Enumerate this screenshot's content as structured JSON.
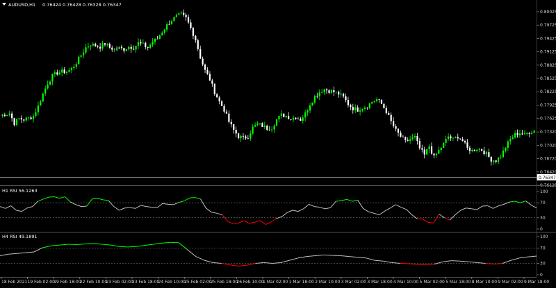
{
  "chart_data": [
    {
      "type": "candlestick",
      "symbol_header": "AUDUSD,H1",
      "ohlc_header": "0.76424 0.76428 0.76328 0.76347",
      "y_ticks": [
        "0.80025",
        "0.79725",
        "0.79425",
        "0.79125",
        "0.78825",
        "0.78525",
        "0.78225",
        "0.77925",
        "0.77625",
        "0.77320",
        "0.77020",
        "0.76720",
        "0.76420",
        "0.76120"
      ],
      "ylim": [
        0.7612,
        0.80025
      ],
      "current_price": "0.76347",
      "bull_color": "#00ff00",
      "bear_color": "#ffffff",
      "x_ticks": [
        "18 Feb 2021",
        "19 Feb 02:00",
        "19 Feb 18:00",
        "22 Feb 10:00",
        "23 Feb 02:00",
        "23 Feb 18:00",
        "24 Feb 10:00",
        "25 Feb 02:00",
        "25 Feb 18:00",
        "26 Feb 10:00",
        "1 Mar 02:00",
        "1 Mar 18:00",
        "2 Mar 10:00",
        "3 Mar 02:00",
        "3 Mar 18:00",
        "4 Mar 10:00",
        "5 Mar 02:00",
        "5 Mar 18:00",
        "8 Mar 10:00",
        "9 Mar 02:00",
        "9 Mar 18:00"
      ],
      "close_path": [
        [
          0,
          0.7768
        ],
        [
          2,
          0.7772
        ],
        [
          4,
          0.7774
        ],
        [
          6,
          0.7752
        ],
        [
          8,
          0.7762
        ],
        [
          10,
          0.776
        ],
        [
          12,
          0.7763
        ],
        [
          14,
          0.7768
        ],
        [
          16,
          0.779
        ],
        [
          18,
          0.7818
        ],
        [
          20,
          0.7842
        ],
        [
          22,
          0.7858
        ],
        [
          24,
          0.7865
        ],
        [
          26,
          0.7868
        ],
        [
          28,
          0.7868
        ],
        [
          30,
          0.7874
        ],
        [
          32,
          0.7888
        ],
        [
          34,
          0.7905
        ],
        [
          36,
          0.7922
        ],
        [
          38,
          0.793
        ],
        [
          40,
          0.7926
        ],
        [
          42,
          0.7924
        ],
        [
          44,
          0.7931
        ],
        [
          46,
          0.7922
        ],
        [
          48,
          0.7918
        ],
        [
          50,
          0.7921
        ],
        [
          52,
          0.7918
        ],
        [
          54,
          0.7924
        ],
        [
          56,
          0.7922
        ],
        [
          58,
          0.7932
        ],
        [
          60,
          0.7928
        ],
        [
          62,
          0.7922
        ],
        [
          64,
          0.7935
        ],
        [
          66,
          0.7942
        ],
        [
          68,
          0.7958
        ],
        [
          70,
          0.7972
        ],
        [
          72,
          0.7984
        ],
        [
          74,
          0.7992
        ],
        [
          76,
          0.7996
        ],
        [
          78,
          0.7988
        ],
        [
          80,
          0.7966
        ],
        [
          82,
          0.794
        ],
        [
          84,
          0.79
        ],
        [
          86,
          0.787
        ],
        [
          88,
          0.785
        ],
        [
          90,
          0.7822
        ],
        [
          92,
          0.78
        ],
        [
          94,
          0.7782
        ],
        [
          96,
          0.7755
        ],
        [
          98,
          0.7736
        ],
        [
          100,
          0.7722
        ],
        [
          102,
          0.7718
        ],
        [
          104,
          0.7722
        ],
        [
          106,
          0.7742
        ],
        [
          108,
          0.775
        ],
        [
          110,
          0.7746
        ],
        [
          112,
          0.774
        ],
        [
          114,
          0.7742
        ],
        [
          116,
          0.776
        ],
        [
          118,
          0.777
        ],
        [
          120,
          0.7768
        ],
        [
          122,
          0.7762
        ],
        [
          124,
          0.7766
        ],
        [
          126,
          0.776
        ],
        [
          128,
          0.7773
        ],
        [
          130,
          0.7795
        ],
        [
          132,
          0.7812
        ],
        [
          134,
          0.7822
        ],
        [
          136,
          0.7828
        ],
        [
          138,
          0.7825
        ],
        [
          140,
          0.7822
        ],
        [
          142,
          0.7818
        ],
        [
          144,
          0.781
        ],
        [
          146,
          0.7795
        ],
        [
          148,
          0.7785
        ],
        [
          150,
          0.7782
        ],
        [
          152,
          0.7787
        ],
        [
          154,
          0.779
        ],
        [
          156,
          0.78
        ],
        [
          158,
          0.7805
        ],
        [
          160,
          0.7795
        ],
        [
          162,
          0.7778
        ],
        [
          164,
          0.7755
        ],
        [
          166,
          0.7735
        ],
        [
          168,
          0.7722
        ],
        [
          170,
          0.771
        ],
        [
          172,
          0.7716
        ],
        [
          174,
          0.772
        ],
        [
          176,
          0.7695
        ],
        [
          178,
          0.768
        ],
        [
          180,
          0.77
        ],
        [
          182,
          0.7675
        ],
        [
          184,
          0.769
        ],
        [
          186,
          0.7705
        ],
        [
          188,
          0.7722
        ],
        [
          190,
          0.7715
        ],
        [
          192,
          0.7722
        ],
        [
          194,
          0.7712
        ],
        [
          196,
          0.7695
        ],
        [
          198,
          0.769
        ],
        [
          200,
          0.7695
        ],
        [
          202,
          0.7692
        ],
        [
          204,
          0.7682
        ],
        [
          206,
          0.767
        ],
        [
          208,
          0.7668
        ],
        [
          210,
          0.7678
        ],
        [
          212,
          0.7698
        ],
        [
          214,
          0.7715
        ],
        [
          216,
          0.7726
        ],
        [
          218,
          0.773
        ],
        [
          220,
          0.7725
        ],
        [
          222,
          0.7732
        ],
        [
          224,
          0.7735
        ]
      ]
    },
    {
      "type": "line",
      "header": "H1 RSI 56.1263",
      "y_ticks": [
        "100",
        "70",
        "30",
        "0"
      ],
      "ylim": [
        0,
        100
      ],
      "levels": [
        70,
        30
      ],
      "overbought_color": "#00ff00",
      "oversold_color": "#ff0000",
      "line_color": "#c0c0c0",
      "values": [
        60,
        55,
        62,
        50,
        47,
        56,
        60,
        74,
        80,
        85,
        86,
        82,
        86,
        72,
        65,
        60,
        61,
        80,
        82,
        78,
        76,
        60,
        50,
        56,
        57,
        55,
        63,
        60,
        58,
        57,
        68,
        66,
        65,
        71,
        75,
        83,
        84,
        80,
        56,
        45,
        42,
        38,
        20,
        14,
        16,
        22,
        15,
        18,
        23,
        12,
        19,
        28,
        33,
        44,
        50,
        47,
        54,
        66,
        60,
        58,
        54,
        57,
        74,
        76,
        79,
        74,
        77,
        55,
        46,
        42,
        38,
        48,
        56,
        65,
        58,
        52,
        38,
        27,
        26,
        18,
        16,
        40,
        30,
        24,
        38,
        50,
        56,
        54,
        52,
        61,
        62,
        55,
        62,
        66,
        72,
        74,
        70,
        75,
        64,
        56
      ]
    },
    {
      "type": "line",
      "header": "H4 RSI 49.1891",
      "y_ticks": [
        "100",
        "70",
        "30",
        "0"
      ],
      "ylim": [
        0,
        100
      ],
      "levels": [
        70,
        30
      ],
      "overbought_color": "#00ff00",
      "oversold_color": "#ff0000",
      "line_color": "#c0c0c0",
      "values": [
        50,
        54,
        56,
        58,
        60,
        71,
        76,
        78,
        80,
        79,
        81,
        82,
        80,
        78,
        74,
        73,
        74,
        77,
        80,
        83,
        85,
        84,
        66,
        48,
        38,
        32,
        30,
        26,
        23,
        25,
        30,
        32,
        30,
        32,
        38,
        44,
        48,
        50,
        52,
        51,
        50,
        48,
        46,
        44,
        38,
        36,
        32,
        30,
        29,
        27,
        26,
        28,
        34,
        37,
        36,
        34,
        32,
        30,
        28,
        30,
        38,
        44,
        47,
        49
      ]
    }
  ]
}
